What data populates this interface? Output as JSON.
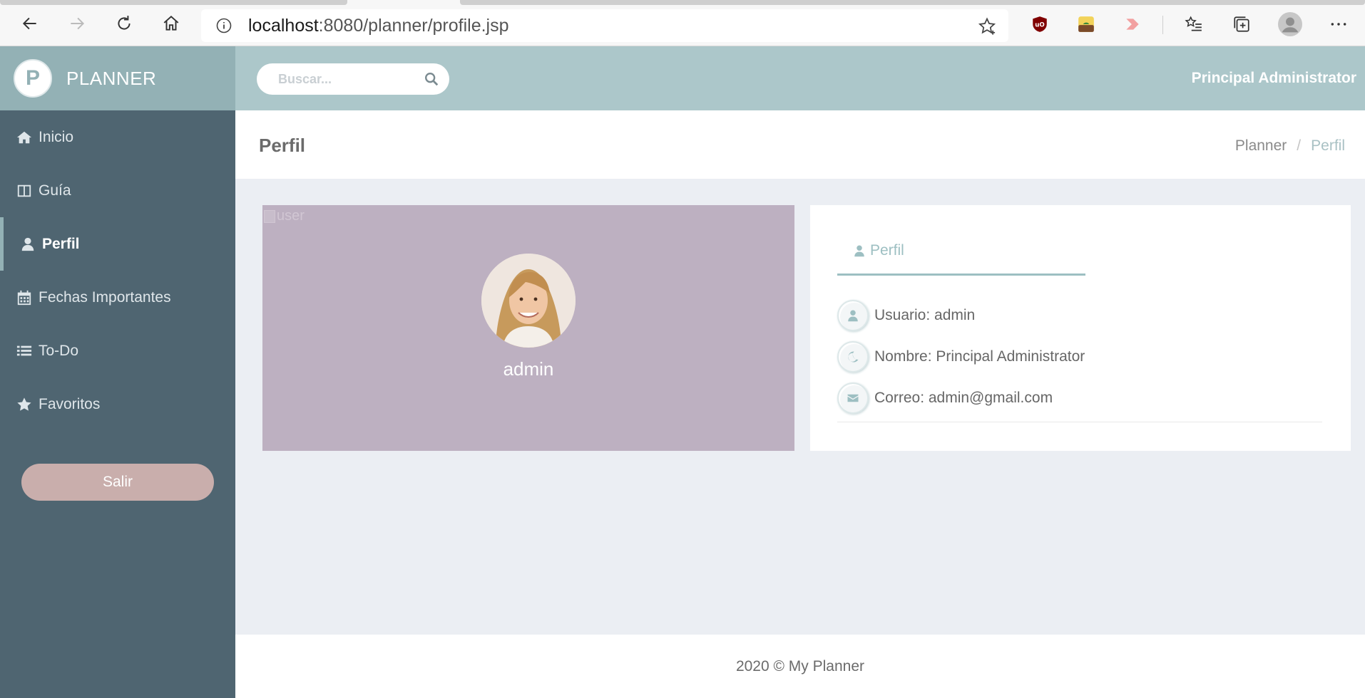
{
  "browser": {
    "url_host": "localhost",
    "url_rest": ":8080/planner/profile.jsp"
  },
  "brand": {
    "logo_letter": "P",
    "name": "PLANNER"
  },
  "sidebar": {
    "items": [
      {
        "label": "Inicio",
        "icon": "home-icon"
      },
      {
        "label": "Guía",
        "icon": "book-icon"
      },
      {
        "label": "Perfil",
        "icon": "user-icon"
      },
      {
        "label": "Fechas Importantes",
        "icon": "calendar-icon"
      },
      {
        "label": "To-Do",
        "icon": "list-icon"
      },
      {
        "label": "Favoritos",
        "icon": "star-icon"
      }
    ],
    "logout_label": "Salir"
  },
  "topbar": {
    "search_placeholder": "Buscar...",
    "user_name": "Principal Administrator"
  },
  "page": {
    "title": "Perfil",
    "breadcrumb": [
      "Planner",
      "Perfil"
    ]
  },
  "profile": {
    "broken_image_alt": "user",
    "username": "admin"
  },
  "info": {
    "tab_label": "Perfil",
    "rows": [
      {
        "label": "Usuario: admin",
        "icon": "user-icon"
      },
      {
        "label": "Nombre: Principal Administrator",
        "icon": "moon-icon"
      },
      {
        "label": "Correo: admin@gmail.com",
        "icon": "envelope-icon"
      }
    ]
  },
  "footer": {
    "text": "2020 © My Planner"
  },
  "colors": {
    "sidebar_bg": "#4f6571",
    "brand_bg": "#93b1b5",
    "topbar_bg": "#acc7ca",
    "profile_card_bg": "#bdb0c1",
    "logout_bg": "#c9aeac",
    "accent": "#9dbfc2"
  }
}
